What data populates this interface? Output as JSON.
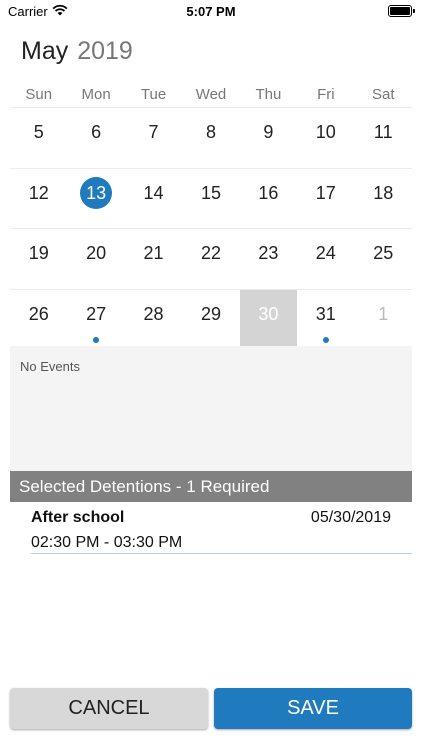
{
  "status_bar": {
    "carrier": "Carrier",
    "time": "5:07 PM"
  },
  "calendar": {
    "month": "May",
    "year": "2019",
    "weekdays": [
      "Sun",
      "Mon",
      "Tue",
      "Wed",
      "Thu",
      "Fri",
      "Sat"
    ],
    "weeks": [
      [
        {
          "day": "5"
        },
        {
          "day": "6"
        },
        {
          "day": "7"
        },
        {
          "day": "8"
        },
        {
          "day": "9"
        },
        {
          "day": "10"
        },
        {
          "day": "11"
        }
      ],
      [
        {
          "day": "12"
        },
        {
          "day": "13",
          "selected": true
        },
        {
          "day": "14"
        },
        {
          "day": "15"
        },
        {
          "day": "16"
        },
        {
          "day": "17"
        },
        {
          "day": "18"
        }
      ],
      [
        {
          "day": "19"
        },
        {
          "day": "20"
        },
        {
          "day": "21"
        },
        {
          "day": "22"
        },
        {
          "day": "23"
        },
        {
          "day": "24"
        },
        {
          "day": "25"
        }
      ],
      [
        {
          "day": "26"
        },
        {
          "day": "27",
          "dot": true
        },
        {
          "day": "28"
        },
        {
          "day": "29"
        },
        {
          "day": "30",
          "highlight": true
        },
        {
          "day": "31",
          "dot": true
        },
        {
          "day": "1",
          "other_month": true
        }
      ]
    ],
    "accent_color": "#1f7bbd"
  },
  "events": {
    "empty_text": "No Events"
  },
  "selected_detentions": {
    "header": "Selected Detentions  - 1 Required",
    "items": [
      {
        "title": "After school",
        "date": "05/30/2019",
        "time_range": "02:30 PM  -  03:30 PM"
      }
    ]
  },
  "buttons": {
    "cancel": "CANCEL",
    "save": "SAVE"
  }
}
